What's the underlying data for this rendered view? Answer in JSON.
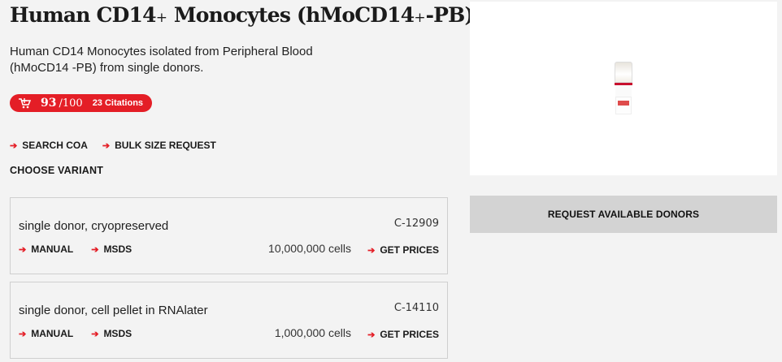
{
  "product": {
    "title_main": "Human CD14",
    "title_sup": "+",
    "title_mid": " Monocytes (hMoCD14",
    "title_sup2": "+",
    "title_end": "-PB)",
    "description": "Human CD14 Monocytes isolated from Peripheral Blood (hMoCD14 -PB) from single donors."
  },
  "badge": {
    "score": "93",
    "out_of": "/100",
    "citations": "23 Citations",
    "icon": "cart-icon",
    "color": "#e41e26"
  },
  "links": {
    "search_coa": "SEARCH COA",
    "bulk_size": "BULK SIZE REQUEST"
  },
  "choose_variant": "CHOOSE VARIANT",
  "variants": [
    {
      "name": "single donor, cryopreserved",
      "code": "C-12909",
      "manual": "MANUAL",
      "msds": "MSDS",
      "cells": "10,000,000 cells",
      "get_prices": "GET PRICES"
    },
    {
      "name": "single donor, cell pellet in RNAlater",
      "code": "C-14110",
      "manual": "MANUAL",
      "msds": "MSDS",
      "cells": "1,000,000 cells",
      "get_prices": "GET PRICES"
    }
  ],
  "request_donors": "REQUEST AVAILABLE DONORS",
  "arrow_glyph": "➔"
}
